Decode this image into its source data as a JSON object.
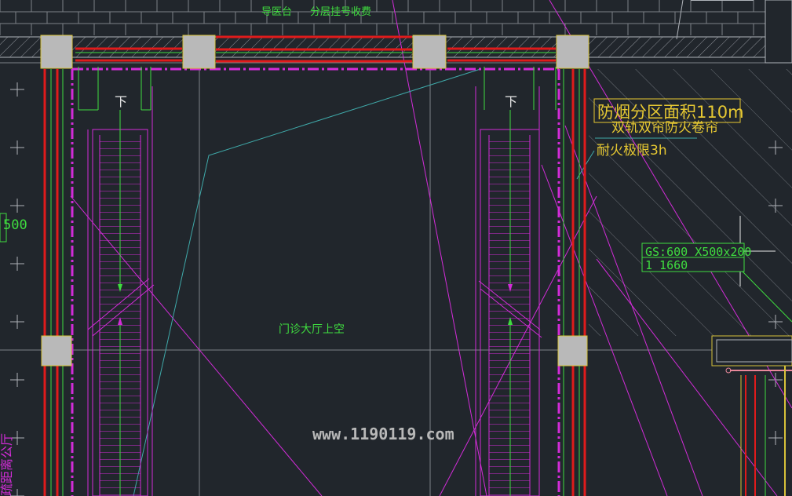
{
  "drawing": {
    "top_label_left": "导医台",
    "top_label_right": "分层挂号收费",
    "down_mark_left": "下",
    "down_mark_right": "下",
    "smoke_zone": "防烟分区面积110m",
    "shutter_line1": "双轨双帘防火卷帘",
    "shutter_line2": "耐火极限3h",
    "tag_line1": "GS:600 X500x200",
    "tag_line2": "1 1660",
    "hall_label": "门诊大厅上空",
    "left_dim": "500",
    "left_vertical": "疏距离公厅",
    "watermark": "www.1190119.com"
  },
  "colors": {
    "background": "#21262c",
    "wall_red": "#e01b1b",
    "stair_magenta": "#d22cd8",
    "text_green": "#3fdc3f",
    "text_yellow": "#e6c832",
    "column_gray": "#b9b9b9",
    "grid_gray": "#7d8187",
    "leader_cyan": "#3fa9a9"
  }
}
